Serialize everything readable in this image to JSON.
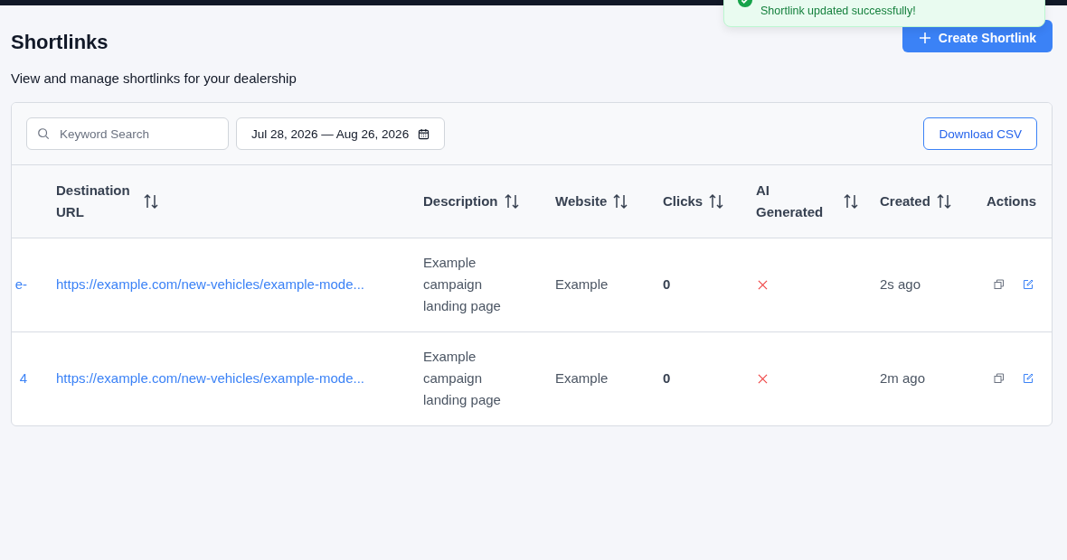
{
  "page": {
    "title": "Shortlinks",
    "subtitle": "View and manage shortlinks for your dealership",
    "create_button": "Create Shortlink"
  },
  "toast": {
    "message": "Shortlink updated successfully!"
  },
  "toolbar": {
    "search": {
      "placeholder": "Keyword Search"
    },
    "date_range": "Jul 28, 2026 — Aug 26, 2026",
    "download_button": "Download CSV"
  },
  "table": {
    "columns": [
      {
        "sortable": false
      },
      {
        "label": "Destination URL",
        "sortable": true
      },
      {
        "label": "Description",
        "sortable": true
      },
      {
        "label": "Website",
        "sortable": true
      },
      {
        "label": "Clicks",
        "sortable": true
      },
      {
        "label": "AI Generated",
        "sortable": true
      },
      {
        "label": "Created",
        "sortable": true
      },
      {
        "label": "Actions",
        "sortable": false
      }
    ],
    "rows": [
      {
        "column_1": "e-",
        "destination_url": "https://example.com/new-vehicles/example-mode...",
        "description": "Example campaign landing page",
        "website": "Example",
        "clicks": "0",
        "ai_generated": false,
        "created": "2s ago"
      },
      {
        "column_1": "4",
        "destination_url": "https://example.com/new-vehicles/example-mode...",
        "description": "Example campaign landing page",
        "website": "Example",
        "clicks": "0",
        "ai_generated": false,
        "created": "2m ago"
      }
    ]
  }
}
